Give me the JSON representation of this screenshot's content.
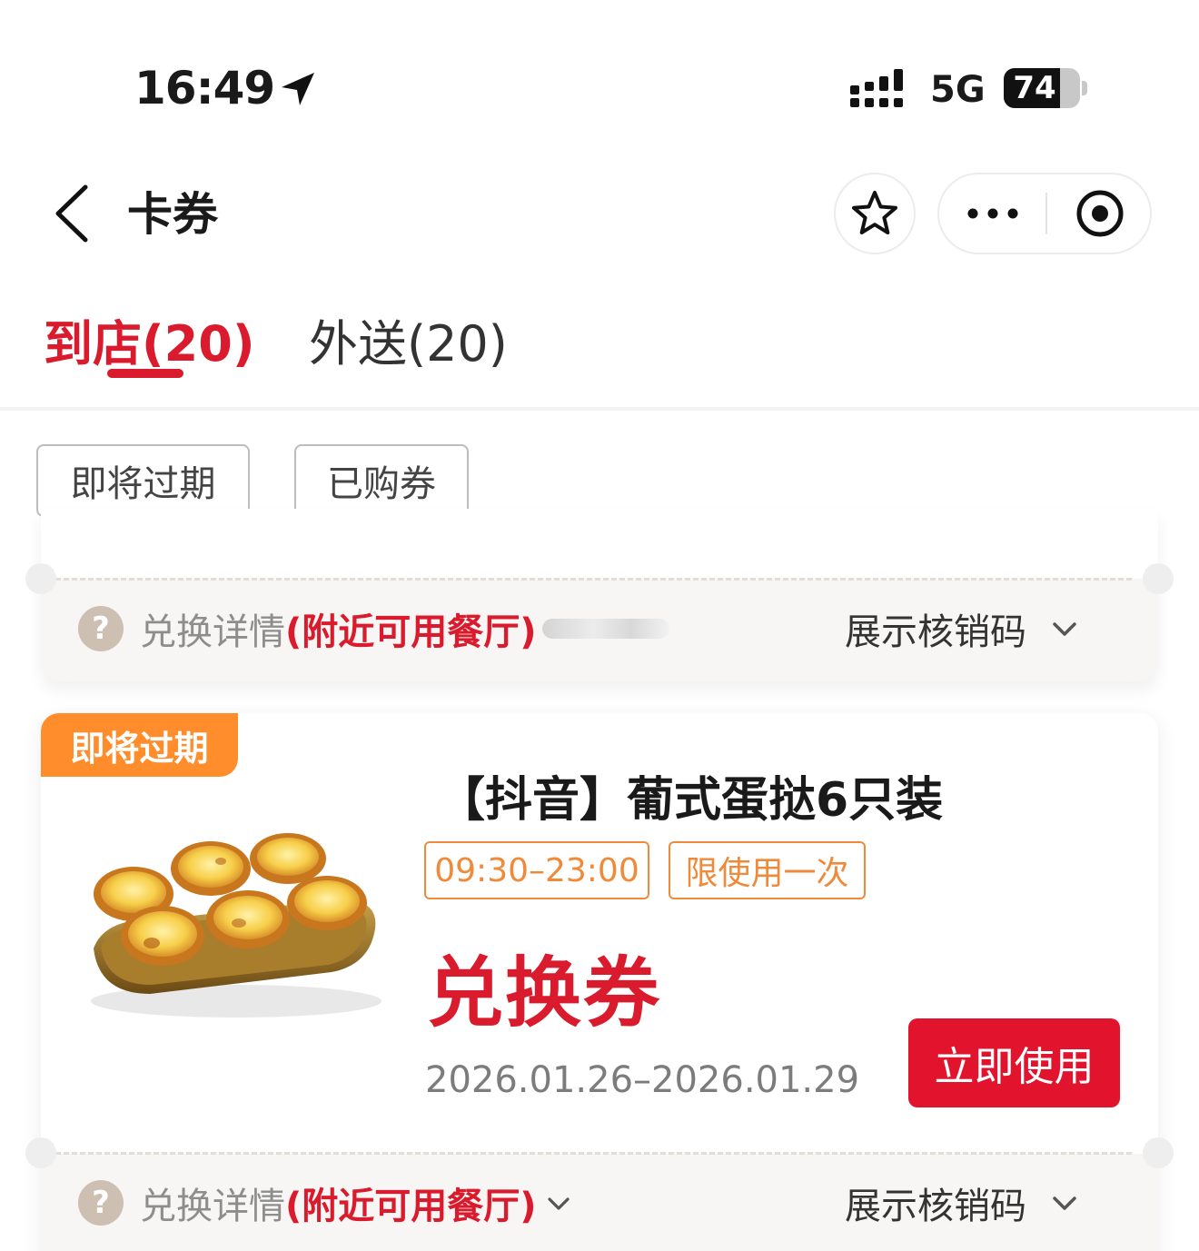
{
  "status_bar": {
    "time": "16:49",
    "network": "5G",
    "battery_level": "74",
    "battery_fraction": 0.74
  },
  "nav": {
    "title": "卡券",
    "back_icon": "chevron-left-icon",
    "star_icon": "star-outline-icon",
    "more_icon": "more-dots-icon",
    "close_icon": "target-circle-icon"
  },
  "tabs": [
    {
      "label": "到店(20)",
      "active": true
    },
    {
      "label": "外送(20)",
      "active": false
    }
  ],
  "filters": [
    {
      "label": "即将过期"
    },
    {
      "label": "已购券"
    }
  ],
  "colors": {
    "accent_red": "#d91b2d",
    "button_red": "#e2132c",
    "badge_orange": "#ff8d2b",
    "tag_orange": "#ef8a3a"
  },
  "coupons": [
    {
      "details_label": "兑换详情",
      "details_link": "(附近可用餐厅)",
      "show_code_label": "展示核销码"
    },
    {
      "badge": "即将过期",
      "title": "【抖音】葡式蛋挞6只装",
      "tags": [
        "09:30–23:00",
        "限使用一次"
      ],
      "type": "兑换券",
      "validity": "2026.01.26–2026.01.29",
      "use_button": "立即使用",
      "details_label": "兑换详情",
      "details_link": "(附近可用餐厅)",
      "show_code_label": "展示核销码"
    }
  ]
}
